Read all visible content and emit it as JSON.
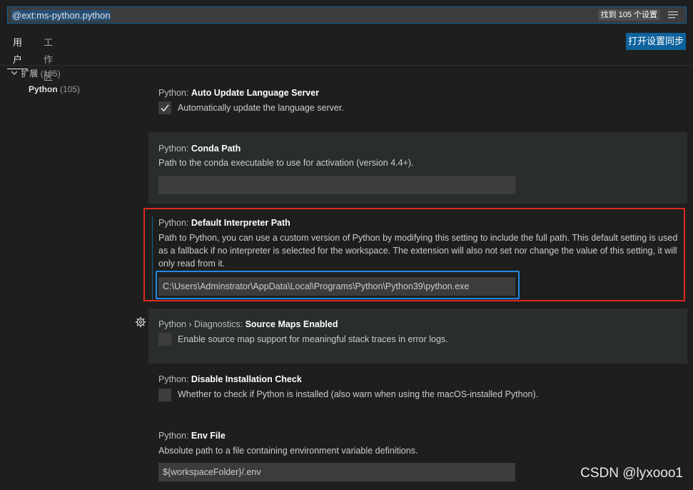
{
  "search": {
    "value": "@ext:ms-python.python",
    "result_count": "找到 105 个设置",
    "filter_icon": "filter-list-icon"
  },
  "tabs": [
    {
      "label": "用户",
      "active": true
    },
    {
      "label": "工作区",
      "active": false
    }
  ],
  "sync_button": "打开设置同步",
  "toc": {
    "parent": {
      "label": "扩展",
      "count": "(105)",
      "icon": "chevron-down-icon"
    },
    "child": {
      "label": "Python",
      "count": "(105)"
    }
  },
  "settings": [
    {
      "category": "Python: ",
      "key": "Auto Update Language Server",
      "type": "checkbox",
      "checked": true,
      "description": "Automatically update the language server."
    },
    {
      "category": "Python: ",
      "key": "Conda Path",
      "type": "text",
      "description": "Path to the conda executable to use for activation (version 4.4+).",
      "value": ""
    },
    {
      "category": "Python: ",
      "key": "Default Interpreter Path",
      "type": "text",
      "description": "Path to Python, you can use a custom version of Python by modifying this setting to include the full path. This default setting is used as a fallback if no interpreter is selected for the workspace. The extension will also not set nor change the value of this setting, it will only read from it.",
      "value": "C:\\Users\\Adminstrator\\AppData\\Local\\Programs\\Python\\Python39\\python.exe"
    },
    {
      "category": "Python › Diagnostics: ",
      "key": "Source Maps Enabled",
      "type": "checkbox",
      "checked": false,
      "description": "Enable source map support for meaningful stack traces in error logs."
    },
    {
      "category": "Python: ",
      "key": "Disable Installation Check",
      "type": "checkbox",
      "checked": false,
      "description": "Whether to check if Python is installed (also warn when using the macOS-installed Python)."
    },
    {
      "category": "Python: ",
      "key": "Env File",
      "type": "text",
      "description": "Absolute path to a file containing environment variable definitions.",
      "value": "${workspaceFolder}/.env"
    }
  ],
  "watermark": "CSDN @lyxooo1",
  "colors": {
    "accent": "#0e639c",
    "highlight_red": "#e0291e",
    "highlight_blue": "#1f8ae6"
  }
}
